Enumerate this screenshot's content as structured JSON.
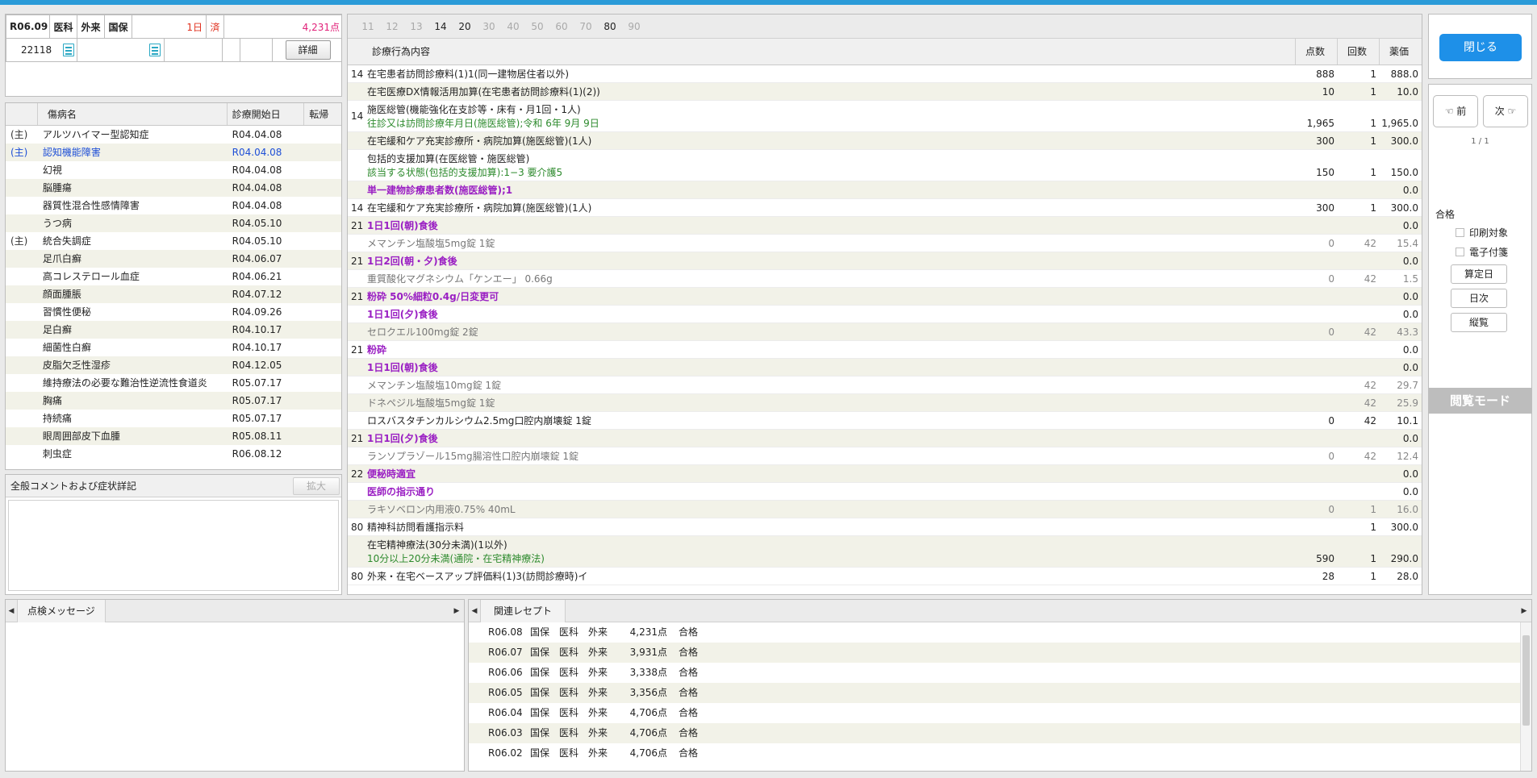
{
  "header": {
    "year_month": "R06.09",
    "dept": "医科",
    "visit_type": "外来",
    "insurance": "国保",
    "days": "1日",
    "done": "済",
    "points": "4,231点",
    "patient_no": "22118",
    "detail_button": "詳細"
  },
  "diseases": {
    "headers": [
      "傷病名",
      "診療開始日",
      "転帰"
    ],
    "rows": [
      {
        "main": "(主)",
        "name": "アルツハイマー型認知症",
        "date": "R04.04.08",
        "outcome": ""
      },
      {
        "main": "(主)",
        "name": "認知機能障害",
        "date": "R04.04.08",
        "outcome": "",
        "highlight": true
      },
      {
        "main": "",
        "name": "幻視",
        "date": "R04.04.08",
        "outcome": ""
      },
      {
        "main": "",
        "name": "脳腫瘍",
        "date": "R04.04.08",
        "outcome": ""
      },
      {
        "main": "",
        "name": "器質性混合性感情障害",
        "date": "R04.04.08",
        "outcome": ""
      },
      {
        "main": "",
        "name": "うつ病",
        "date": "R04.05.10",
        "outcome": ""
      },
      {
        "main": "(主)",
        "name": "統合失調症",
        "date": "R04.05.10",
        "outcome": ""
      },
      {
        "main": "",
        "name": "足爪白癬",
        "date": "R04.06.07",
        "outcome": ""
      },
      {
        "main": "",
        "name": "高コレステロール血症",
        "date": "R04.06.21",
        "outcome": ""
      },
      {
        "main": "",
        "name": "顔面腫脹",
        "date": "R04.07.12",
        "outcome": ""
      },
      {
        "main": "",
        "name": "習慣性便秘",
        "date": "R04.09.26",
        "outcome": ""
      },
      {
        "main": "",
        "name": "足白癬",
        "date": "R04.10.17",
        "outcome": ""
      },
      {
        "main": "",
        "name": "細菌性白癬",
        "date": "R04.10.17",
        "outcome": ""
      },
      {
        "main": "",
        "name": "皮脂欠乏性湿疹",
        "date": "R04.12.05",
        "outcome": ""
      },
      {
        "main": "",
        "name": "維持療法の必要な難治性逆流性食道炎",
        "date": "R05.07.17",
        "outcome": ""
      },
      {
        "main": "",
        "name": "胸痛",
        "date": "R05.07.17",
        "outcome": ""
      },
      {
        "main": "",
        "name": "持続痛",
        "date": "R05.07.17",
        "outcome": ""
      },
      {
        "main": "",
        "name": "眼周囲部皮下血腫",
        "date": "R05.08.11",
        "outcome": ""
      },
      {
        "main": "",
        "name": "刺虫症",
        "date": "R06.08.12",
        "outcome": ""
      }
    ]
  },
  "comment": {
    "title": "全般コメントおよび症状詳記",
    "expand_button": "拡大"
  },
  "treatment": {
    "tabs": [
      {
        "label": "11",
        "active": false
      },
      {
        "label": "12",
        "active": false
      },
      {
        "label": "13",
        "active": false
      },
      {
        "label": "14",
        "active": true
      },
      {
        "label": "20",
        "active": true
      },
      {
        "label": "30",
        "active": false
      },
      {
        "label": "40",
        "active": false
      },
      {
        "label": "50",
        "active": false
      },
      {
        "label": "60",
        "active": false
      },
      {
        "label": "70",
        "active": false
      },
      {
        "label": "80",
        "active": true
      },
      {
        "label": "90",
        "active": false
      }
    ],
    "headers": {
      "content": "診療行為内容",
      "points": "点数",
      "count": "回数",
      "price": "薬価"
    },
    "rows": [
      {
        "code": "14",
        "lines": [
          {
            "t": "在宅患者訪問診療料(1)1(同一建物居住者以外)",
            "s": "norm"
          }
        ],
        "pts": "888",
        "cnt": "1",
        "price": "888.0"
      },
      {
        "code": "",
        "lines": [
          {
            "t": "在宅医療DX情報活用加算(在宅患者訪問診療料(1)(2))",
            "s": "norm"
          }
        ],
        "pts": "10",
        "cnt": "1",
        "price": "10.0"
      },
      {
        "code": "14",
        "lines": [
          {
            "t": "施医総管(機能強化在支診等・床有・月1回・1人)",
            "s": "norm"
          },
          {
            "t": "往診又は訪問診療年月日(施医総管);令和 6年 9月 9日",
            "s": "green"
          }
        ],
        "pts": "1,965",
        "cnt": "1",
        "price": "1,965.0"
      },
      {
        "code": "",
        "lines": [
          {
            "t": "在宅緩和ケア充実診療所・病院加算(施医総管)(1人)",
            "s": "norm"
          }
        ],
        "pts": "300",
        "cnt": "1",
        "price": "300.0"
      },
      {
        "code": "",
        "lines": [
          {
            "t": "包括的支援加算(在医総管・施医総管)",
            "s": "norm"
          },
          {
            "t": "該当する状態(包括的支援加算):1−3 要介護5",
            "s": "green"
          }
        ],
        "pts": "150",
        "cnt": "1",
        "price": "150.0"
      },
      {
        "code": "",
        "lines": [
          {
            "t": "単一建物診療患者数(施医総管);1",
            "s": "purple"
          }
        ],
        "pts": "",
        "cnt": "",
        "price": "0.0"
      },
      {
        "code": "14",
        "lines": [
          {
            "t": "在宅緩和ケア充実診療所・病院加算(施医総管)(1人)",
            "s": "norm"
          }
        ],
        "pts": "300",
        "cnt": "1",
        "price": "300.0"
      },
      {
        "code": "21",
        "lines": [
          {
            "t": "1日1回(朝)食後",
            "s": "purple"
          }
        ],
        "pts": "",
        "cnt": "",
        "price": "0.0"
      },
      {
        "code": "",
        "lines": [
          {
            "t": "メマンチン塩酸塩5mg錠 1錠",
            "s": "gray"
          }
        ],
        "pts": "0",
        "cnt": "42",
        "price": "15.4",
        "gray": true
      },
      {
        "code": "21",
        "lines": [
          {
            "t": "1日2回(朝・夕)食後",
            "s": "purple"
          }
        ],
        "pts": "",
        "cnt": "",
        "price": "0.0"
      },
      {
        "code": "",
        "lines": [
          {
            "t": "重質酸化マグネシウム「ケンエー」 0.66g",
            "s": "gray"
          }
        ],
        "pts": "0",
        "cnt": "42",
        "price": "1.5",
        "gray": true
      },
      {
        "code": "21",
        "lines": [
          {
            "t": "粉砕 50%細粒0.4g/日変更可",
            "s": "purple"
          }
        ],
        "pts": "",
        "cnt": "",
        "price": "0.0"
      },
      {
        "code": "",
        "lines": [
          {
            "t": "1日1回(夕)食後",
            "s": "purple"
          }
        ],
        "pts": "",
        "cnt": "",
        "price": "0.0"
      },
      {
        "code": "",
        "lines": [
          {
            "t": "セロクエル100mg錠 2錠",
            "s": "gray"
          }
        ],
        "pts": "0",
        "cnt": "42",
        "price": "43.3",
        "gray": true
      },
      {
        "code": "21",
        "lines": [
          {
            "t": "粉砕",
            "s": "purple"
          }
        ],
        "pts": "",
        "cnt": "",
        "price": "0.0"
      },
      {
        "code": "",
        "lines": [
          {
            "t": "1日1回(朝)食後",
            "s": "purple"
          }
        ],
        "pts": "",
        "cnt": "",
        "price": "0.0"
      },
      {
        "code": "",
        "lines": [
          {
            "t": "メマンチン塩酸塩10mg錠 1錠",
            "s": "gray"
          }
        ],
        "pts": "",
        "cnt": "42",
        "price": "29.7",
        "gray": true
      },
      {
        "code": "",
        "lines": [
          {
            "t": "ドネペジル塩酸塩5mg錠 1錠",
            "s": "gray"
          }
        ],
        "pts": "",
        "cnt": "42",
        "price": "25.9",
        "gray": true
      },
      {
        "code": "",
        "lines": [
          {
            "t": "ロスバスタチンカルシウム2.5mg口腔内崩壊錠 1錠",
            "s": "norm"
          }
        ],
        "pts": "0",
        "cnt": "42",
        "price": "10.1"
      },
      {
        "code": "21",
        "lines": [
          {
            "t": "1日1回(夕)食後",
            "s": "purple"
          }
        ],
        "pts": "",
        "cnt": "",
        "price": "0.0"
      },
      {
        "code": "",
        "lines": [
          {
            "t": "ランソプラゾール15mg腸溶性口腔内崩壊錠 1錠",
            "s": "gray"
          }
        ],
        "pts": "0",
        "cnt": "42",
        "price": "12.4",
        "gray": true
      },
      {
        "code": "22",
        "lines": [
          {
            "t": "便秘時適宜",
            "s": "purple"
          }
        ],
        "pts": "",
        "cnt": "",
        "price": "0.0"
      },
      {
        "code": "",
        "lines": [
          {
            "t": "医師の指示通り",
            "s": "purple"
          }
        ],
        "pts": "",
        "cnt": "",
        "price": "0.0"
      },
      {
        "code": "",
        "lines": [
          {
            "t": "ラキソベロン内用液0.75% 40mL",
            "s": "gray"
          }
        ],
        "pts": "0",
        "cnt": "1",
        "price": "16.0",
        "gray": true
      },
      {
        "code": "80",
        "lines": [
          {
            "t": "精神科訪問看護指示料",
            "s": "norm"
          }
        ],
        "pts": "",
        "cnt": "1",
        "price": "300.0"
      },
      {
        "code": "",
        "lines": [
          {
            "t": "在宅精神療法(30分未満)(1以外)",
            "s": "norm"
          },
          {
            "t": "10分以上20分未満(通院・在宅精神療法)",
            "s": "green"
          }
        ],
        "pts": "590",
        "cnt": "1",
        "price": "290.0"
      },
      {
        "code": "80",
        "lines": [
          {
            "t": "外来・在宅ベースアップ評価料(1)3(訪問診療時)イ",
            "s": "norm"
          }
        ],
        "pts": "28",
        "cnt": "1",
        "price": "28.0"
      }
    ]
  },
  "right_panel": {
    "close_button": "閉じる",
    "prev_button": "☜ 前",
    "next_button": "次 ☞",
    "pager": "1 / 1",
    "status": "合格",
    "print_target": "印刷対象",
    "e_attach": "電子付箋",
    "calc_day_button": "算定日",
    "daily_button": "日次",
    "vertical_button": "縦覧",
    "mode_label": "閲覧モード"
  },
  "check_messages": {
    "tab_label": "点検メッセージ"
  },
  "related": {
    "tab_label": "関連レセプト",
    "rows": [
      {
        "date": "R06.08",
        "ins": "国保",
        "dept": "医科",
        "type": "外来",
        "pts": "4,231点",
        "status": "合格"
      },
      {
        "date": "R06.07",
        "ins": "国保",
        "dept": "医科",
        "type": "外来",
        "pts": "3,931点",
        "status": "合格"
      },
      {
        "date": "R06.06",
        "ins": "国保",
        "dept": "医科",
        "type": "外来",
        "pts": "3,338点",
        "status": "合格"
      },
      {
        "date": "R06.05",
        "ins": "国保",
        "dept": "医科",
        "type": "外来",
        "pts": "3,356点",
        "status": "合格"
      },
      {
        "date": "R06.04",
        "ins": "国保",
        "dept": "医科",
        "type": "外来",
        "pts": "4,706点",
        "status": "合格"
      },
      {
        "date": "R06.03",
        "ins": "国保",
        "dept": "医科",
        "type": "外来",
        "pts": "4,706点",
        "status": "合格"
      },
      {
        "date": "R06.02",
        "ins": "国保",
        "dept": "医科",
        "type": "外来",
        "pts": "4,706点",
        "status": "合格"
      }
    ]
  }
}
